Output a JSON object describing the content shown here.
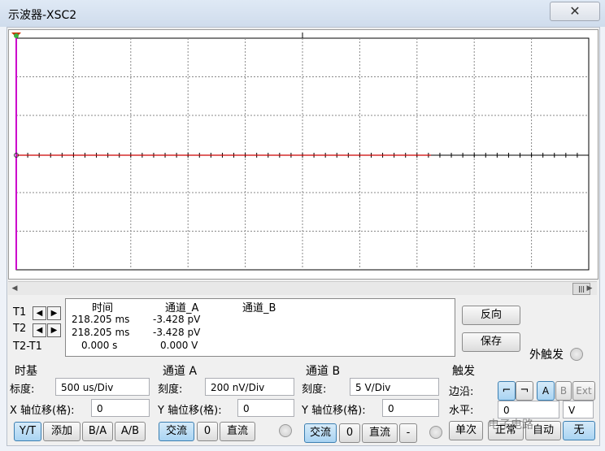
{
  "window": {
    "title": "示波器-XSC2",
    "close_icon": "✕"
  },
  "readout": {
    "row_labels": [
      "T1",
      "T2",
      "T2-T1"
    ],
    "col_time": "时间",
    "col_a": "通道_A",
    "col_b": "通道_B",
    "t1_time": "218.205 ms",
    "t1_a": "-3.428 pV",
    "t2_time": "218.205 ms",
    "t2_a": "-3.428 pV",
    "dt_time": "0.000 s",
    "dt_a": "0.000 V"
  },
  "actions": {
    "reverse": "反向",
    "save": "保存",
    "ext_trigger": "外触发"
  },
  "timebase": {
    "title": "时基",
    "scale_label": "标度:",
    "scale_value": "500 us/Div",
    "xpos_label": "X 轴位移(格):",
    "xpos_value": "0",
    "buttons": [
      "Y/T",
      "添加",
      "B/A",
      "A/B"
    ]
  },
  "channel_a": {
    "title": "通道 A",
    "scale_label": "刻度:",
    "scale_value": "200 nV/Div",
    "ypos_label": "Y 轴位移(格):",
    "ypos_value": "0",
    "buttons": [
      "交流",
      "0",
      "直流"
    ]
  },
  "channel_b": {
    "title": "通道 B",
    "scale_label": "刻度:",
    "scale_value": "5  V/Div",
    "ypos_label": "Y 轴位移(格):",
    "ypos_value": "0",
    "buttons": [
      "交流",
      "0",
      "直流",
      "-"
    ]
  },
  "trigger": {
    "title": "触发",
    "edge_label": "边沿:",
    "level_label": "水平:",
    "level_value": "0",
    "level_unit": "V",
    "source_buttons": [
      "A",
      "B",
      "Ext"
    ],
    "mode_buttons": [
      "单次",
      "正常",
      "自动",
      "无"
    ]
  },
  "watermark": "电子电路",
  "colors": {
    "trace_a": "#cc0000",
    "cursor": "#cc00cc",
    "active_button": "#a8d3f2"
  }
}
